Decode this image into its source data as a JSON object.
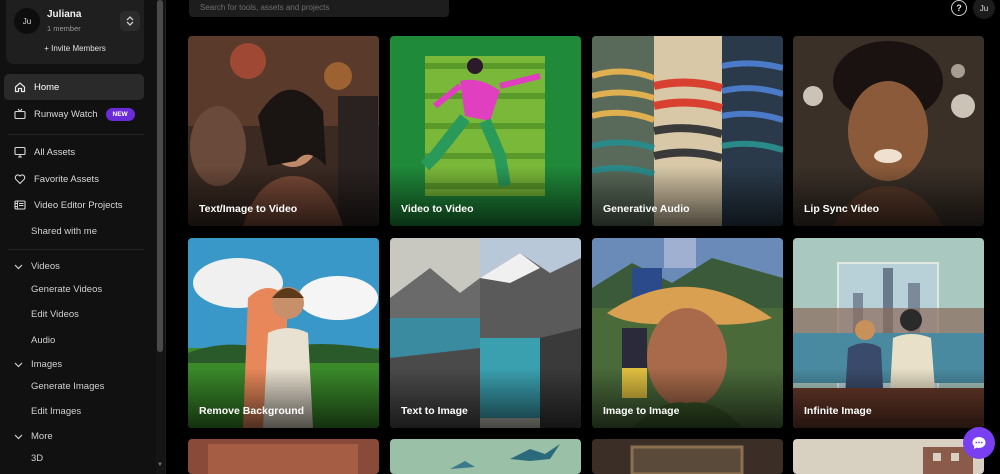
{
  "workspace": {
    "avatar_initials": "Ju",
    "name": "Juliana",
    "members": "1 member",
    "invite_label": "+ Invite Members"
  },
  "nav": {
    "home": "Home",
    "watch": "Runway Watch",
    "watch_badge": "NEW",
    "all_assets": "All Assets",
    "favorite_assets": "Favorite Assets",
    "video_projects": "Video Editor Projects",
    "shared": "Shared with me",
    "videos": {
      "label": "Videos",
      "items": [
        "Generate Videos",
        "Edit Videos",
        "Audio"
      ]
    },
    "images": {
      "label": "Images",
      "items": [
        "Generate Images",
        "Edit Images"
      ]
    },
    "more": {
      "label": "More",
      "items": [
        "3D"
      ]
    }
  },
  "search": {
    "placeholder": "Search for tools, assets and projects"
  },
  "topbar": {
    "help_symbol": "?",
    "user_initials": "Ju"
  },
  "tools": [
    {
      "label": "Text/Image to Video"
    },
    {
      "label": "Video to Video"
    },
    {
      "label": "Generative Audio"
    },
    {
      "label": "Lip Sync Video"
    },
    {
      "label": "Remove Background"
    },
    {
      "label": "Text to Image"
    },
    {
      "label": "Image to Image"
    },
    {
      "label": "Infinite Image"
    }
  ],
  "colors": {
    "accent": "#6c2bd9",
    "chat_button": "#7b3ff2",
    "sidebar_bg": "#111111",
    "active_item": "#2a2a2a"
  },
  "icons": [
    "home-icon",
    "watch-icon",
    "monitor-icon",
    "heart-icon",
    "film-icon",
    "chevron-down-icon",
    "question-icon",
    "chat-icon",
    "chevron-up-down-icon"
  ]
}
